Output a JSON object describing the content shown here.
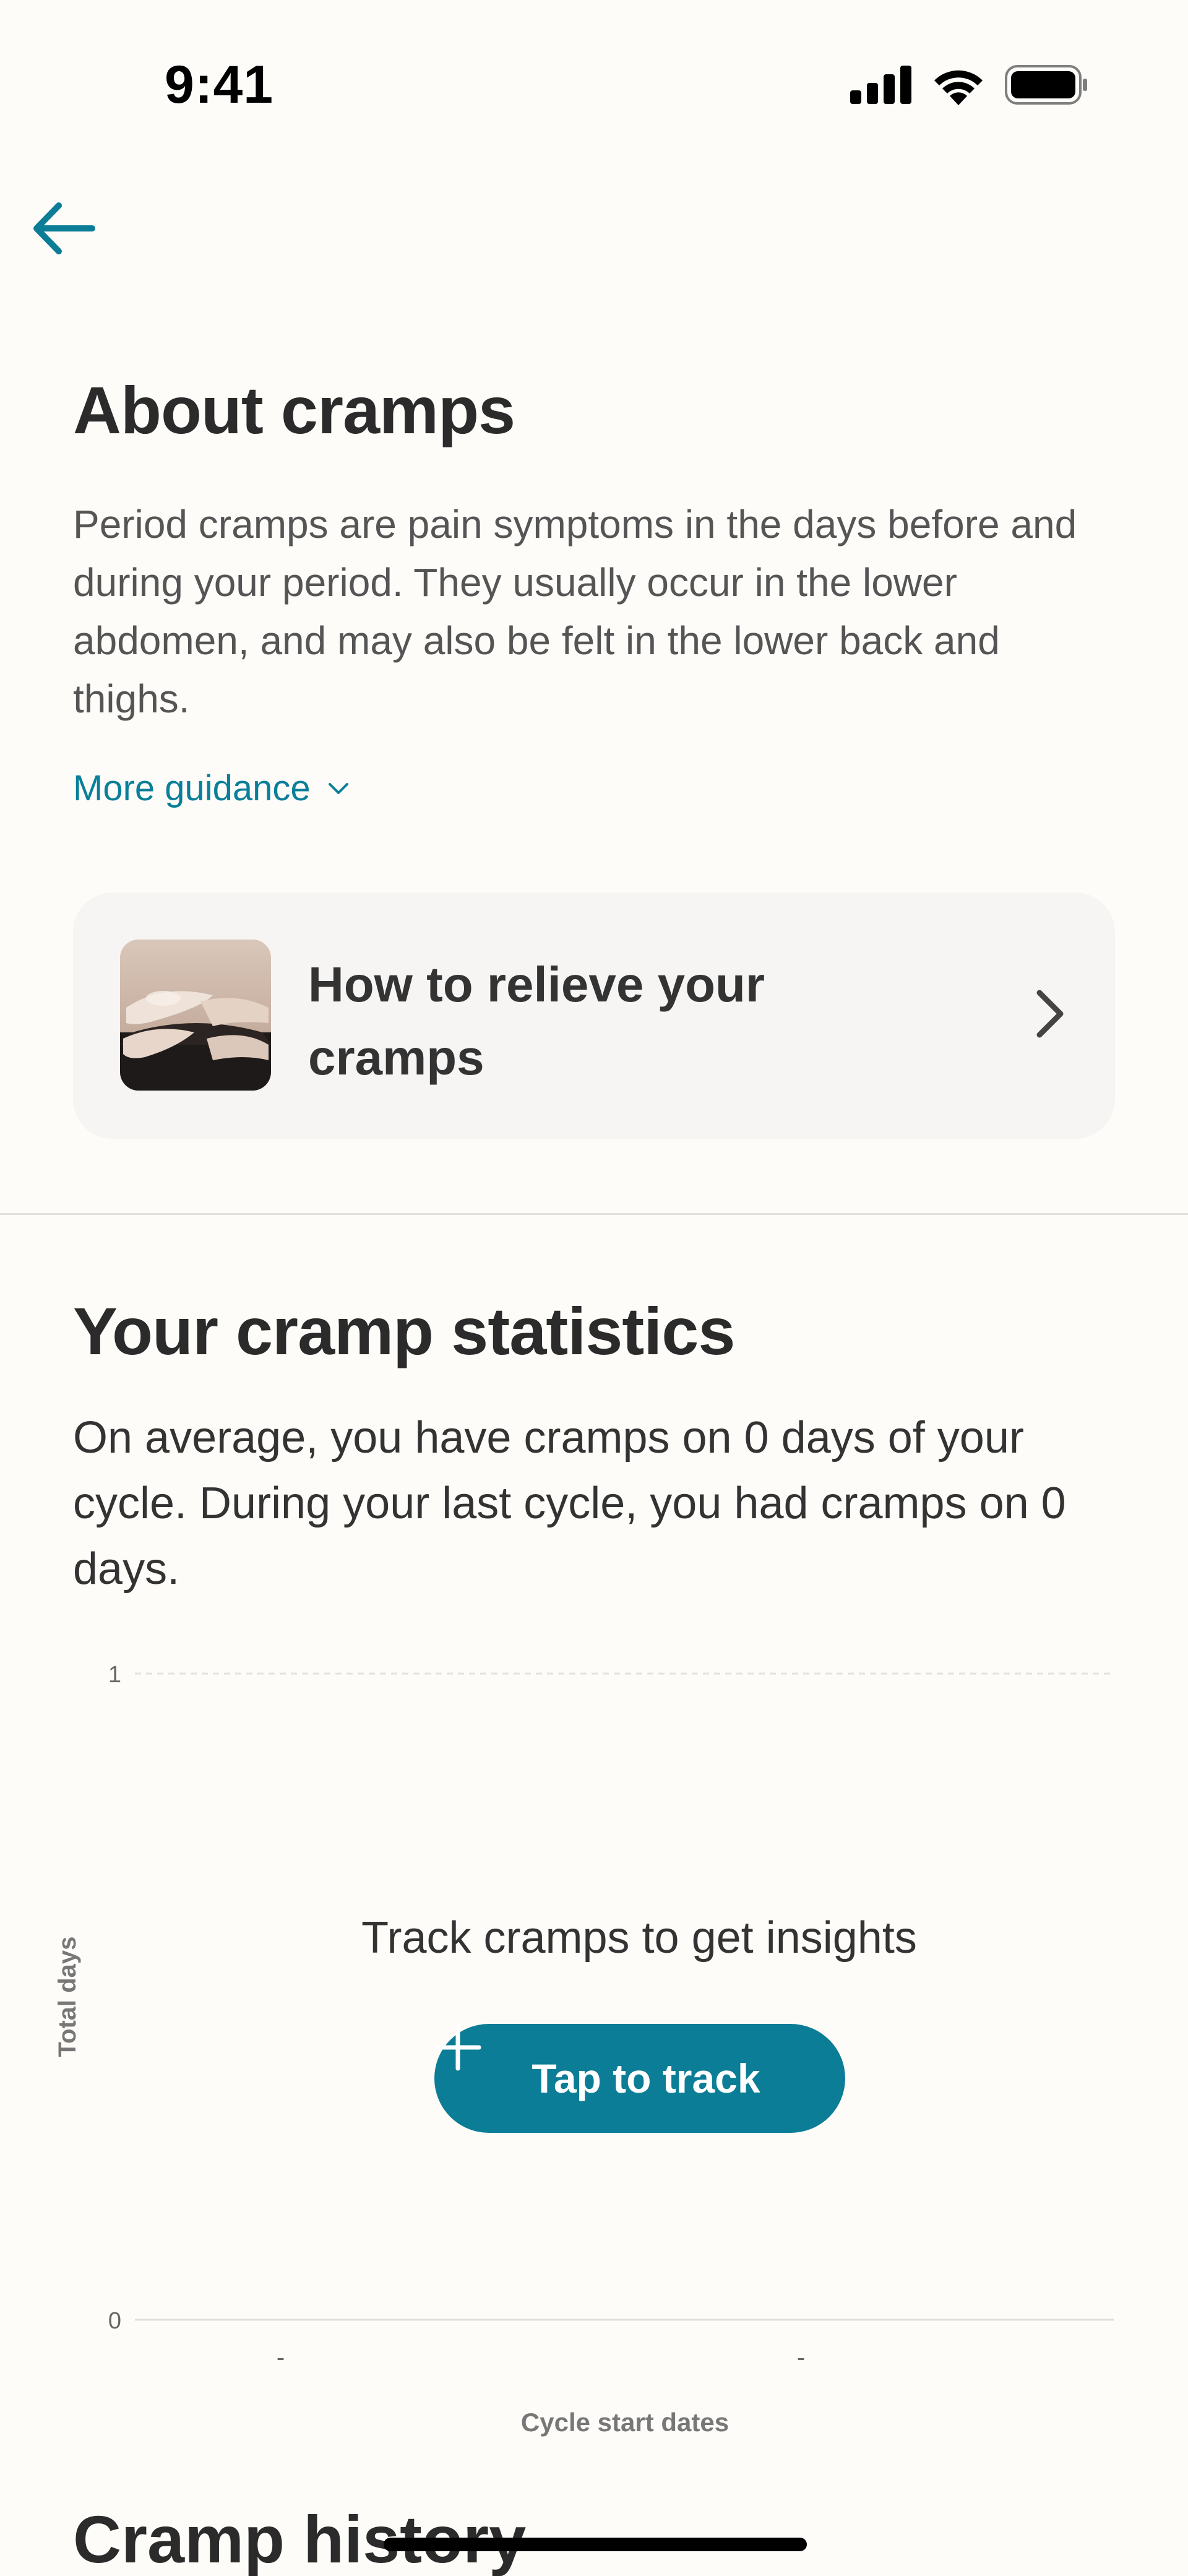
{
  "status_bar": {
    "time": "9:41"
  },
  "about": {
    "title": "About cramps",
    "description": "Period cramps are pain symptoms in the days before and during your period. They usually occur in the lower abdomen, and may also be felt in the lower back and thighs.",
    "more_guidance_label": "More guidance"
  },
  "relief_card": {
    "title": "How to relieve your cramps"
  },
  "statistics": {
    "title": "Your cramp statistics",
    "summary": "On average, you have cramps on 0 days of your cycle. During your last cycle, you had cramps on 0 days.",
    "empty_message": "Track cramps to get insights",
    "track_button_label": "Tap to track"
  },
  "chart_data": {
    "type": "bar",
    "categories": [
      "-",
      "-"
    ],
    "values": [],
    "title": "",
    "xlabel": "Cycle start dates",
    "ylabel": "Total days",
    "ylim": [
      0,
      1
    ],
    "y_ticks": [
      "0",
      "1"
    ],
    "grid": true
  },
  "history": {
    "title": "Cramp history"
  },
  "colors": {
    "accent": "#0B7D96",
    "link": "#0A7F99",
    "background": "#FDFCF9",
    "card": "#F6F5F3"
  },
  "icons": {
    "back": "arrow-left-icon",
    "more": "chevron-down-icon",
    "card": "chevron-right-icon",
    "track": "plus-icon"
  }
}
